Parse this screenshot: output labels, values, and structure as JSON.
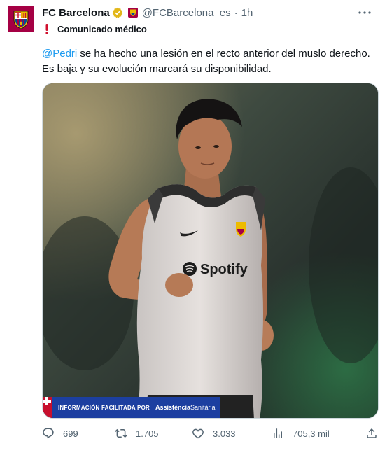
{
  "tweet": {
    "author_name": "FC Barcelona",
    "handle": "@FCBarcelona_es",
    "separator": "·",
    "time": "1h",
    "label": "Comunicado médico",
    "mention": "@Pedri",
    "body": " se ha hecho una lesión en el recto anterior del muslo derecho. Es baja y su evolución marcará su disponibilidad.",
    "jersey_sponsor": "Spotify",
    "banner_text": "INFORMACIÓN FACILITADA POR",
    "banner_brand_bold": "Assistència",
    "banner_brand_light": "Sanitària",
    "stats": {
      "replies": "699",
      "reposts": "1.705",
      "likes": "3.033",
      "views": "705,3 mil"
    },
    "colors": {
      "link": "#1d9bf0",
      "muted": "#536471",
      "brand": "#a50044"
    }
  }
}
